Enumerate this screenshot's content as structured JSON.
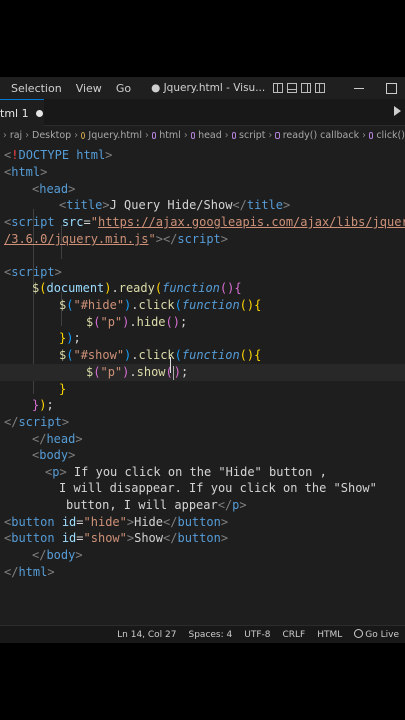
{
  "menu": {
    "items": [
      "Selection",
      "View",
      "Go"
    ]
  },
  "window": {
    "title": "● Jquery.html - Visu..."
  },
  "tab": {
    "label": "tml 1"
  },
  "breadcrumb": [
    "raj",
    "Desktop",
    "Jquery.html",
    "html",
    "head",
    "script",
    "ready() callback",
    "click()"
  ],
  "code": {
    "l1": "<!DOCTYPE html>",
    "doctype": "DOCTYPE html",
    "html": "html",
    "head": "head",
    "title_tag": "title",
    "title_text": "J Query Hide/Show",
    "script": "script",
    "src": "src",
    "src_url_1": "https://ajax.googleapis.com/ajax/libs/jquery",
    "src_url_2": "/3.6.0/jquery.min.js",
    "document": "document",
    "ready": "ready",
    "function": "function",
    "sel_hide": "\"#hide\"",
    "sel_show": "\"#show\"",
    "sel_p": "\"p\"",
    "click": "click",
    "hide": "hide",
    "show": "show",
    "body": "body",
    "p": "p",
    "ptext_1": " If you click on the \"Hide\" button ,",
    "ptext_2": "I will disappear. If you click on the \"Show\"",
    "ptext_3": "button, I will appear",
    "button": "button",
    "id": "id",
    "id_hide": "\"hide\"",
    "id_show": "\"show\"",
    "btn_hide_text": "Hide",
    "btn_show_text": "Show"
  },
  "status": {
    "position": "Ln 14, Col 27",
    "spaces": "Spaces: 4",
    "encoding": "UTF-8",
    "eol": "CRLF",
    "language": "HTML",
    "golive": "Go Live"
  }
}
